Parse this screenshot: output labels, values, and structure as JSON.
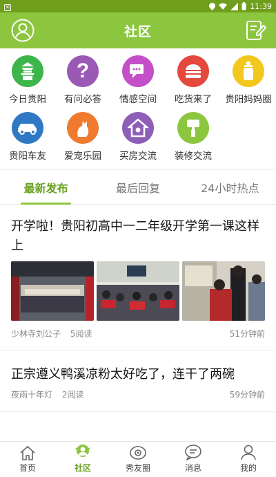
{
  "status_bar": {
    "time": "11:39"
  },
  "header": {
    "title": "社区"
  },
  "categories": [
    {
      "label": "今日贵阳",
      "icon": "pavilion-icon",
      "color": "#3cb54a"
    },
    {
      "label": "有问必答",
      "icon": "question-icon",
      "color": "#9b59b6"
    },
    {
      "label": "情感空间",
      "icon": "chat-icon",
      "color": "#c34fc9"
    },
    {
      "label": "吃货来了",
      "icon": "burger-icon",
      "color": "#e5483c"
    },
    {
      "label": "贵阳妈妈圈",
      "icon": "baby-bottle-icon",
      "color": "#f2c81e"
    },
    {
      "label": "贵阳车友",
      "icon": "car-icon",
      "color": "#2f78c4"
    },
    {
      "label": "爱宠乐园",
      "icon": "cat-icon",
      "color": "#f07a2d"
    },
    {
      "label": "买房交流",
      "icon": "house-icon",
      "color": "#8e5fb6"
    },
    {
      "label": "装修交流",
      "icon": "paint-icon",
      "color": "#8cc63f"
    }
  ],
  "tabs": [
    {
      "label": "最新发布",
      "active": true
    },
    {
      "label": "最后回复",
      "active": false
    },
    {
      "label": "24小时热点",
      "active": false
    }
  ],
  "posts": [
    {
      "title": "开学啦！贵阳初高中一二年级开学第一课这样上",
      "author": "少林寺刘公子",
      "reads": "5阅读",
      "time": "51分钟前",
      "has_images": true
    },
    {
      "title": "正宗遵义鸭溪凉粉太好吃了，连干了两碗",
      "author": "夜雨十年灯",
      "reads": "2阅读",
      "time": "59分钟前",
      "has_images": false
    }
  ],
  "bottom_nav": [
    {
      "label": "首页",
      "icon": "home-icon",
      "active": false
    },
    {
      "label": "社区",
      "icon": "community-icon",
      "active": true
    },
    {
      "label": "秀友圈",
      "icon": "camera-icon",
      "active": false
    },
    {
      "label": "消息",
      "icon": "message-icon",
      "active": false
    },
    {
      "label": "我的",
      "icon": "user-icon",
      "active": false
    }
  ],
  "colors": {
    "brand": "#8cc63f",
    "brand_dark": "#6f9e1c",
    "active_text": "#6aa121"
  }
}
